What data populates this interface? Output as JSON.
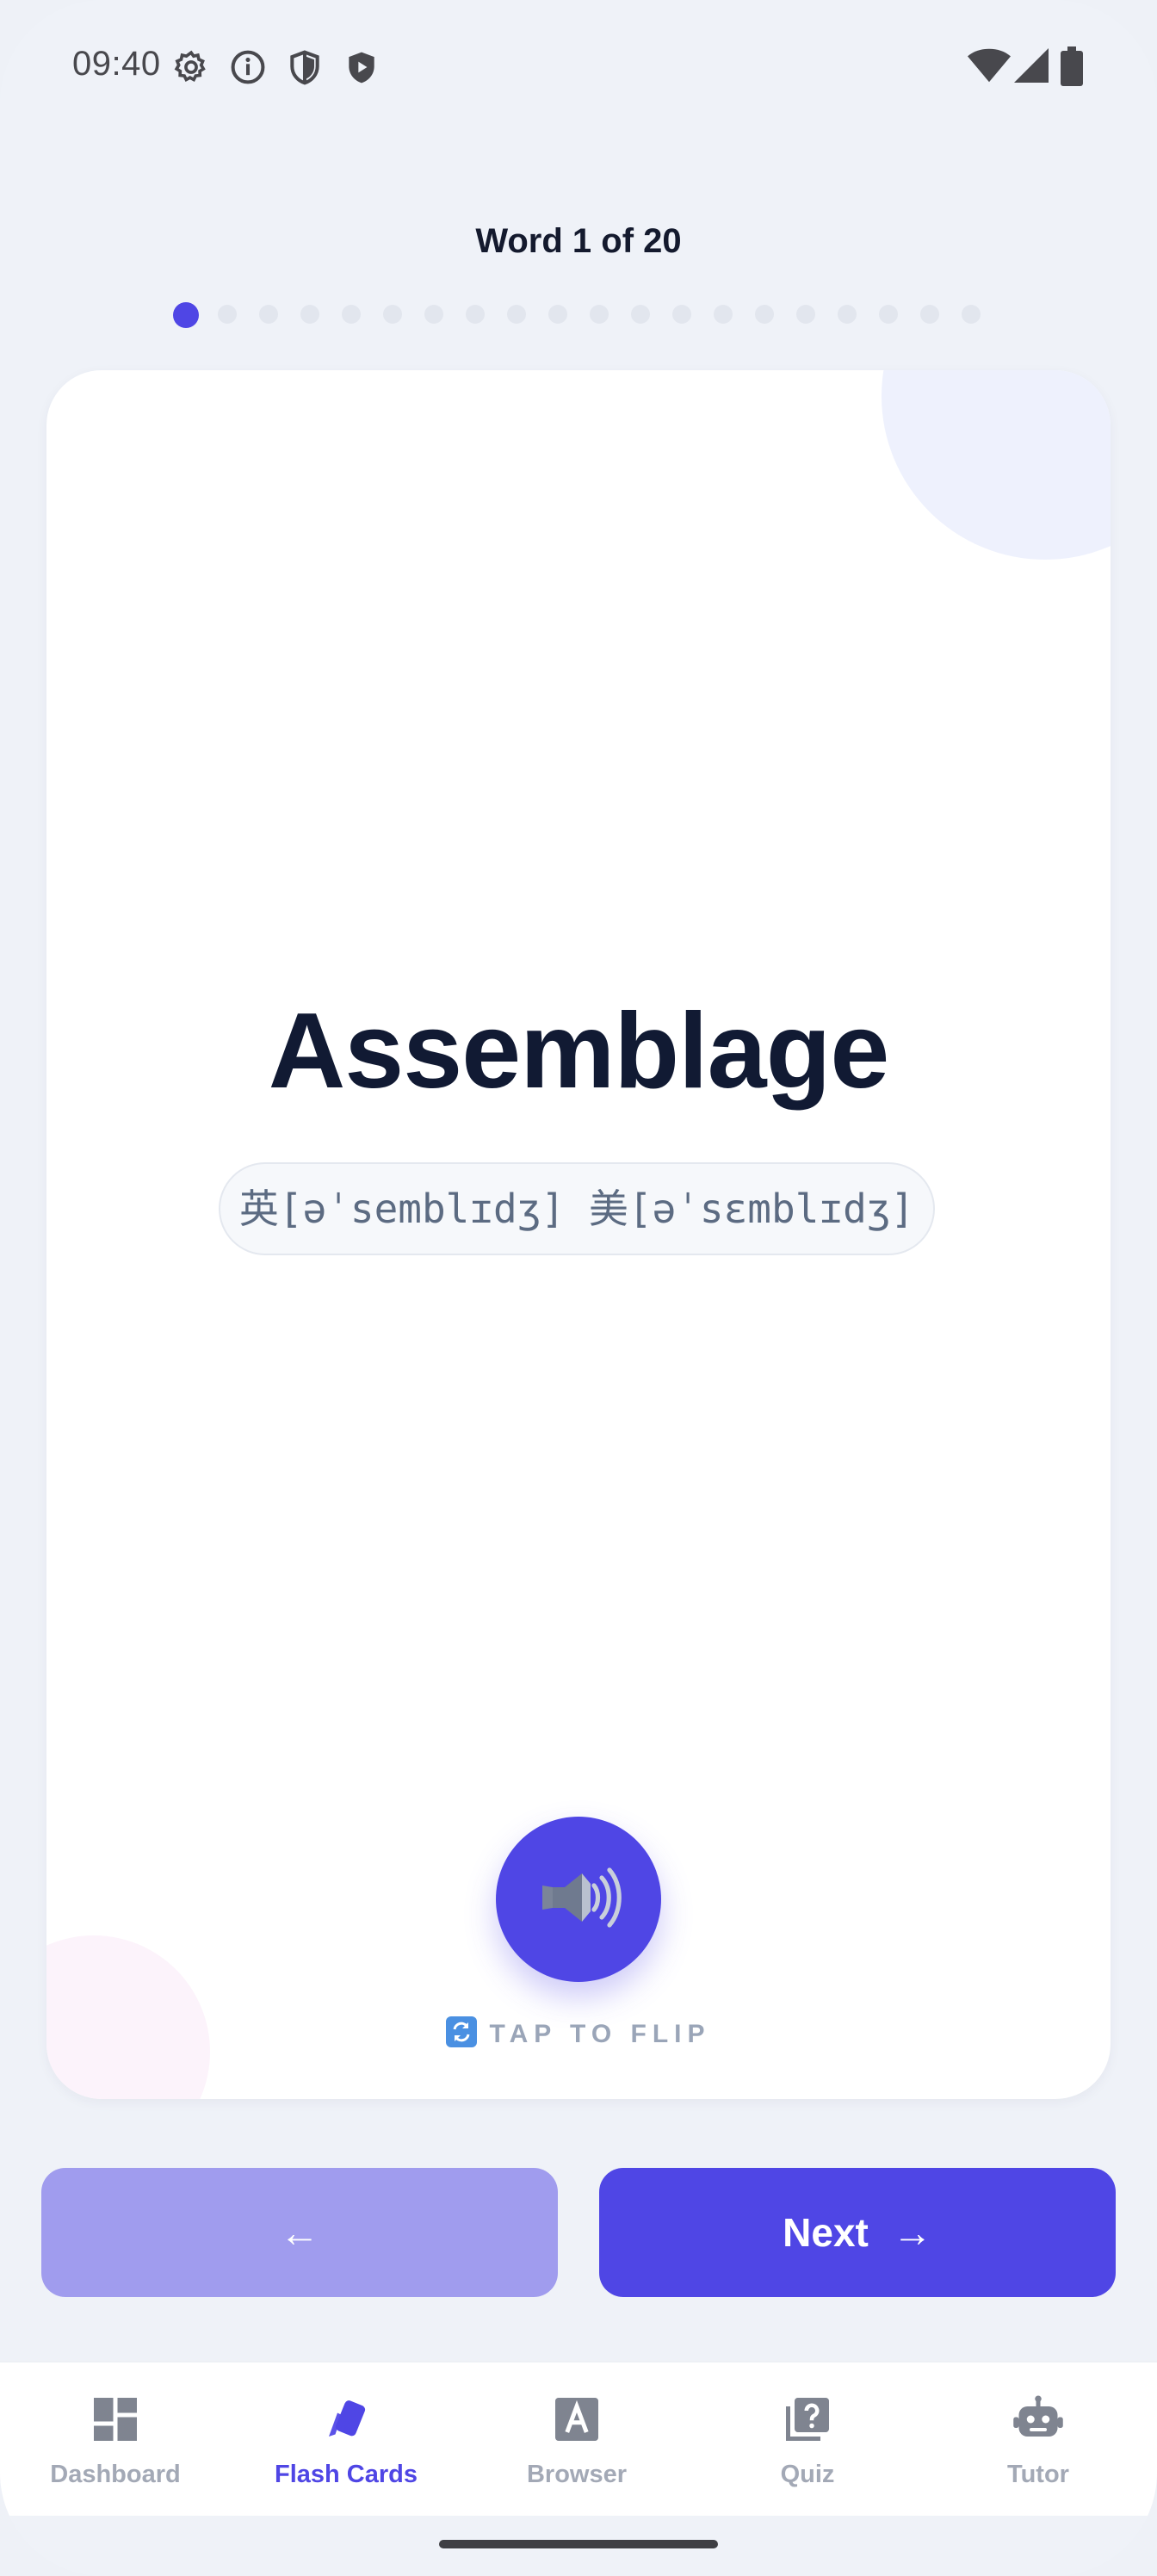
{
  "status_bar": {
    "time": "09:40",
    "left_icons": [
      "gear-icon",
      "info-icon",
      "shield-icon",
      "play-shield-icon"
    ],
    "right_icons": [
      "wifi-icon",
      "signal-icon",
      "battery-icon"
    ]
  },
  "progress": {
    "title": "Word 1 of 20",
    "current": 1,
    "total": 20
  },
  "card": {
    "word": "Assemblage",
    "phonetic": "英[əˈsemblɪdʒ] 美[əˈsɛmblɪdʒ]",
    "speak_icon": "speaker-icon",
    "hint_icon": "flip-icon",
    "hint": "TAP TO FLIP"
  },
  "buttons": {
    "prev_label": "←",
    "next_label": "Next",
    "next_arrow": "→"
  },
  "bottom_nav": {
    "items": [
      {
        "label": "Dashboard",
        "icon": "dashboard-icon",
        "active": false
      },
      {
        "label": "Flash Cards",
        "icon": "flash-cards-icon",
        "active": true
      },
      {
        "label": "Browser",
        "icon": "browser-icon",
        "active": false
      },
      {
        "label": "Quiz",
        "icon": "quiz-icon",
        "active": false
      },
      {
        "label": "Tutor",
        "icon": "tutor-icon",
        "active": false
      }
    ]
  },
  "colors": {
    "accent": "#4f46e5",
    "accent_disabled": "#a09cee",
    "background": "#eff2f8",
    "text_dark": "#111a33",
    "inactive": "#a3a9b6"
  }
}
